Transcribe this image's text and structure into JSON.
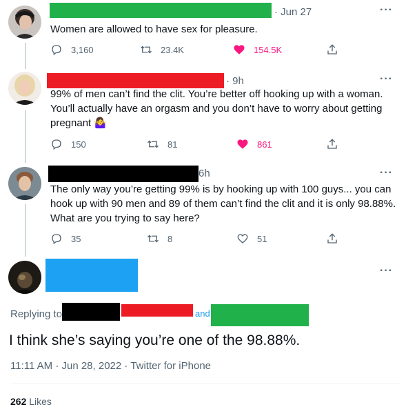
{
  "tweets": [
    {
      "date": "· Jun 27",
      "text": "Women are allowed to have sex for pleasure.",
      "replies": "3,160",
      "retweets": "23.4K",
      "likes": "154.5K",
      "liked": true
    },
    {
      "date": "· 9h",
      "text": "99% of men can’t find the clit. You’re better off hooking up with a woman. You’ll actually have an orgasm and you don’t have to worry about getting pregnant 🤷‍♀️",
      "replies": "150",
      "retweets": "81",
      "likes": "861",
      "liked": true
    },
    {
      "date": "6h",
      "text": "The only way you’re getting 99% is by hooking up with 100 guys... you can hook up with 90 men and 89 of them can’t find the clit and it is only 98.88%. What are you trying to say here?",
      "replies": "35",
      "retweets": "8",
      "likes": "51",
      "liked": false
    }
  ],
  "main": {
    "replying_to": "Replying to",
    "and": "and",
    "text": "I think she’s saying you’re one of the 98.88%.",
    "timestamp": "11:11 AM · Jun 28, 2022 · Twitter for iPhone",
    "likes_count": "262",
    "likes_label": "Likes"
  },
  "more_glyph": "···",
  "colors": {
    "green": "#21b14b",
    "red": "#ed1c24",
    "black": "#000000",
    "blue": "#1da1f2",
    "like": "#f91880",
    "gray": "#536471"
  }
}
